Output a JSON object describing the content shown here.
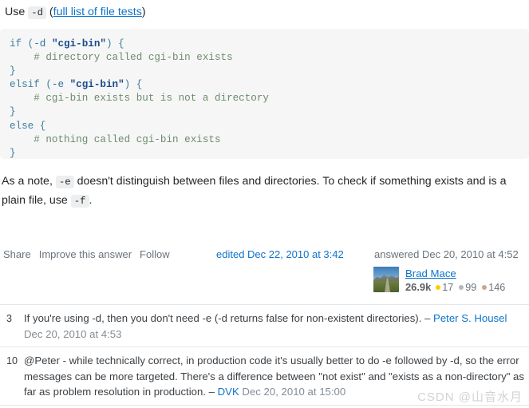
{
  "intro": {
    "prefix": "Use",
    "code": "-d",
    "paren_open": "(",
    "link_text": "full list of file tests",
    "paren_close": ")"
  },
  "code_block": {
    "language": "perl",
    "lines": [
      [
        {
          "t": "if",
          "c": "kw"
        },
        {
          "t": " (",
          "c": "op"
        },
        {
          "t": "-d",
          "c": "pl"
        },
        {
          "t": " ",
          "c": "pl"
        },
        {
          "t": "\"cgi-bin\"",
          "c": "str"
        },
        {
          "t": ") {",
          "c": "op"
        }
      ],
      [
        {
          "t": "    # directory called cgi-bin exists",
          "c": "cm"
        }
      ],
      [
        {
          "t": "}",
          "c": "op"
        }
      ],
      [
        {
          "t": "elsif",
          "c": "kw"
        },
        {
          "t": " (",
          "c": "op"
        },
        {
          "t": "-e",
          "c": "pl"
        },
        {
          "t": " ",
          "c": "pl"
        },
        {
          "t": "\"cgi-bin\"",
          "c": "str"
        },
        {
          "t": ") {",
          "c": "op"
        }
      ],
      [
        {
          "t": "    # cgi-bin exists but is not a directory",
          "c": "cm"
        }
      ],
      [
        {
          "t": "}",
          "c": "op"
        }
      ],
      [
        {
          "t": "else",
          "c": "kw"
        },
        {
          "t": " {",
          "c": "op"
        }
      ],
      [
        {
          "t": "    # nothing called cgi-bin exists",
          "c": "cm"
        }
      ],
      [
        {
          "t": "}",
          "c": "op"
        }
      ]
    ],
    "plain_text": "if (-d \"cgi-bin\") {\n    # directory called cgi-bin exists\n}\nelsif (-e \"cgi-bin\") {\n    # cgi-bin exists but is not a directory\n}\nelse {\n    # nothing called cgi-bin exists\n}"
  },
  "note": {
    "part1": "As a note,",
    "code1": "-e",
    "part2": "doesn't distinguish between files and directories. To check if something exists and is a plain file, use",
    "code2": "-f",
    "part3": "."
  },
  "actionbar": {
    "share_label": "Share",
    "improve_label": "Improve this answer",
    "follow_label": "Follow",
    "edited_label": "edited Dec 22, 2010 at 3:42",
    "answered_label": "answered Dec 20, 2010 at 4:52"
  },
  "user": {
    "name": "Brad Mace",
    "reputation": "26.9k",
    "gold": "17",
    "silver": "99",
    "bronze": "146",
    "avatar_alt": "landscape-photo-avatar"
  },
  "comments": [
    {
      "score": "3",
      "text": "If you're using -d, then you don't need -e (-d returns false for non-existent directories).",
      "dash": "–",
      "author": "Peter S. Housel",
      "time": "Dec 20, 2010 at 4:53"
    },
    {
      "score": "10",
      "text": "@Peter - while technically correct, in production code it's usually better to do -e followed by -d, so the error messages can be more targeted. There's a difference between \"not exist\" and \"exists as a non-directory\" as far as problem resolution in production.",
      "dash": "–",
      "author": "DVK",
      "time": "Dec 20, 2010 at 15:00"
    }
  ],
  "watermark": {
    "text": "CSDN @山音水月"
  },
  "colors": {
    "link": "#0c73cc",
    "muted": "#6a737c",
    "code_bg": "#f6f6f6",
    "chip_bg": "#eceeef",
    "gold": "#ffcc01",
    "silver": "#b4b8bc",
    "bronze": "#d1a684",
    "divider": "#e3e6e8",
    "watermark": "#d0d3d6"
  }
}
